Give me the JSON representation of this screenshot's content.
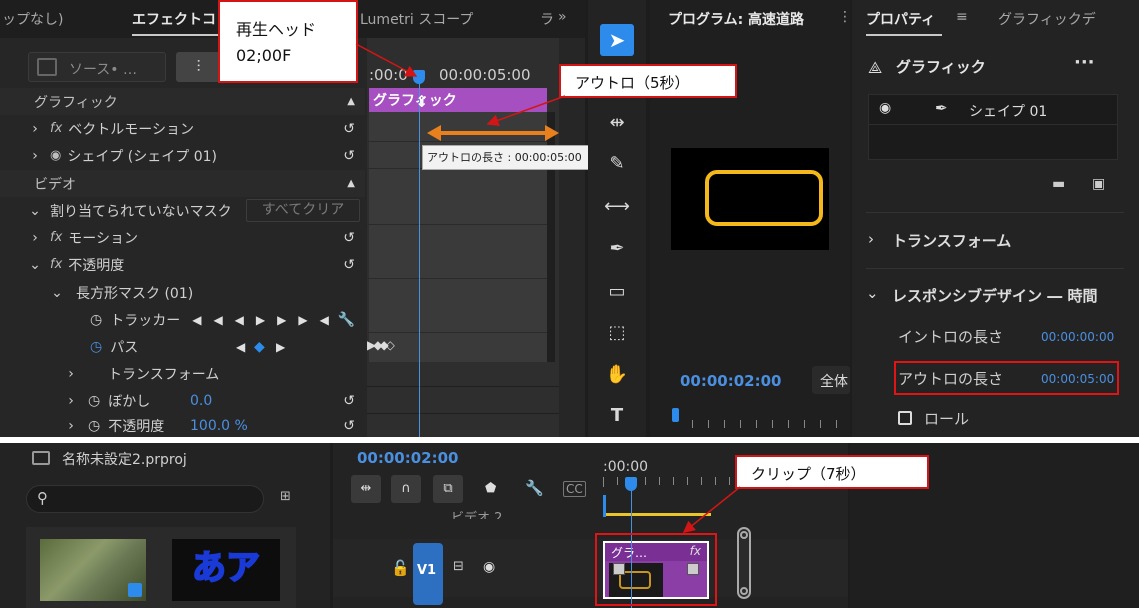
{
  "effects_panel": {
    "tabs": [
      "ップなし)",
      "エフェクトコ",
      "Lumetri スコープ",
      "ラ"
    ],
    "source_label": "ソース• …",
    "graphics_section": "グラフィック",
    "rows": [
      {
        "label": "ベクトルモーション"
      },
      {
        "label": "シェイプ (シェイプ 01)"
      }
    ],
    "video_section": "ビデオ",
    "mask_label": "割り当てられていないマスク",
    "clear_all": "すべてクリア",
    "motion": "モーション",
    "opacity": "不透明度",
    "rect_mask": "長方形マスク (01)",
    "tracker": "トラッカー",
    "path": "パス",
    "transform": "トランスフォーム",
    "feather": "ぼかし",
    "feather_value": "0.0",
    "mask_opacity": "不透明度",
    "mask_opacity_value": "100.0 %"
  },
  "mini_timeline": {
    "time_start": ":00:0",
    "time_end": "00:00:05:00",
    "clip_label": "グラフィック",
    "tooltip": "アウトロの長さ : 00:00:05:00"
  },
  "callouts": {
    "playhead": "再生ヘッド",
    "playhead_time": "02;00F",
    "outro": "アウトロ（5秒）",
    "clip": "クリップ（7秒）"
  },
  "program_panel": {
    "title": "プログラム: 高速道路",
    "timecode": "00:00:02:00",
    "fit": "全体"
  },
  "properties_panel": {
    "tabs": [
      "プロパティ",
      "グラフィックデ"
    ],
    "graphic": "グラフィック",
    "shape": "シェイプ 01",
    "transform": "トランスフォーム",
    "responsive": "レスポンシブデザイン ― 時間",
    "intro_label": "イントロの長さ",
    "intro_value": "00:00:00:00",
    "outro_label": "アウトロの長さ",
    "outro_value": "00:00:05:00",
    "roll": "ロール"
  },
  "project_panel": {
    "name": "名称未設定2.prproj",
    "thumb_text": "あア"
  },
  "timeline_panel": {
    "timecode": "00:00:02:00",
    "ruler": ":00:00",
    "video2": "ビデオ 2",
    "v1": "V1",
    "clip_label": "グラ…",
    "fx": "fx"
  },
  "colors": {
    "accent_blue": "#2d8ceb",
    "clip_purple": "#a54fc0",
    "callout_red": "#d41515",
    "shape_yellow": "#f4b81a",
    "outro_arrow": "#e8801e"
  }
}
